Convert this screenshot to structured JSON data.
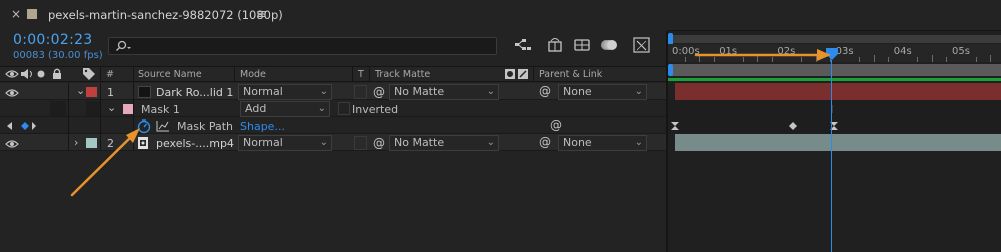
{
  "tab": {
    "close_glyph": "×",
    "comp_name": "pexels-martin-sanchez-9882072 (1080p)",
    "menu_glyph": "≡"
  },
  "timecode": {
    "value": "0:00:02:23",
    "frames": "00083 (30.00 fps)",
    "search_placeholder": ""
  },
  "headers": {
    "num": "#",
    "source_name": "Source Name",
    "mode": "Mode",
    "t": "T",
    "track_matte": "Track Matte",
    "parent_link": "Parent & Link"
  },
  "layers": [
    {
      "number": "1",
      "name": "Dark Ro...lid 1",
      "mode": "Normal",
      "track_matte": "No Matte",
      "parent": "None",
      "label_color": "#c0403e",
      "bar_color": "#7a2e2e"
    },
    {
      "number": "2",
      "name": "pexels-....mp4",
      "mode": "Normal",
      "track_matte": "No Matte",
      "parent": "None",
      "label_color": "#a3c8c3",
      "bar_color": "#778b8a"
    }
  ],
  "mask": {
    "name": "Mask 1",
    "mode": "Add",
    "inverted_label": "Inverted",
    "label_color": "#e8a7c0",
    "property": "Mask Path",
    "value": "Shape..."
  },
  "timeline": {
    "ruler_labels": [
      "0:00s",
      "01s",
      "02s",
      "03s",
      "04s",
      "05s"
    ],
    "playhead_time_seconds": 2.77
  },
  "colors": {
    "accent": "#2d8ceb",
    "arrow": "#e8922c",
    "work_area": "#5a5a5a",
    "timecode": "#4aa3f0"
  },
  "icons": [
    "eye-icon",
    "audio-icon",
    "solo-icon",
    "lock-icon",
    "label-icon",
    "comp-flowchart-icon",
    "draft-3d-icon",
    "shy-icon",
    "frame-blending-icon",
    "motion-blur-icon",
    "graph-editor-icon",
    "stopwatch-icon",
    "keyframe-diamond-icon",
    "pickwhip-icon",
    "layer-footage-icon"
  ]
}
